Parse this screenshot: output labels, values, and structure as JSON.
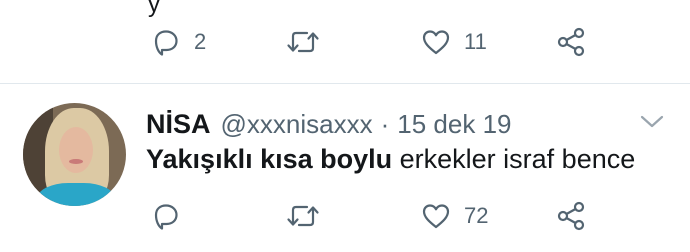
{
  "previous_tweet": {
    "text_fragment": "y",
    "actions": {
      "reply_count": "2",
      "retweet_count": "",
      "like_count": "11"
    }
  },
  "tweet": {
    "display_name": "NİSA",
    "handle": "@xxxnisaxxx",
    "separator": "·",
    "date": "15 dek 19",
    "text_bold": "Yakışıklı kısa boylu",
    "text_rest": " erkekler israf bence",
    "actions": {
      "reply_count": "",
      "retweet_count": "",
      "like_count": "72"
    }
  },
  "icons": {
    "reply": "reply-icon",
    "retweet": "retweet-icon",
    "like": "heart-icon",
    "share": "share-icon",
    "more": "chevron-down-icon"
  },
  "colors": {
    "icon": "#536471",
    "divider": "#e1e8ed",
    "text": "#14171a"
  }
}
